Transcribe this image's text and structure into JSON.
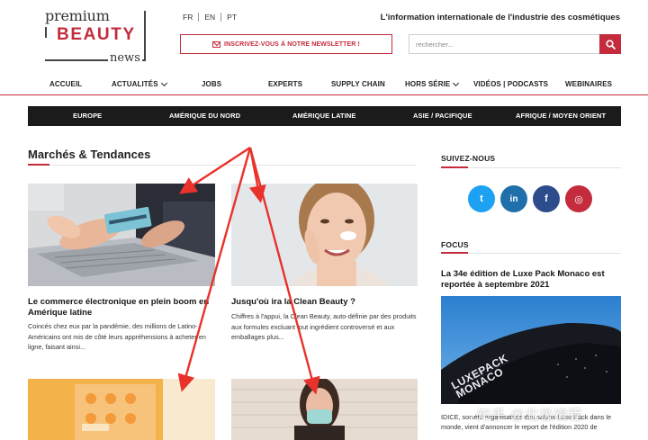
{
  "header": {
    "logo": {
      "line1": "premium",
      "line2": "BEAUTY",
      "line3": "news"
    },
    "languages": [
      "FR",
      "EN",
      "PT"
    ],
    "tagline": "L'information internationale de l'industrie des cosmétiques",
    "newsletter_label": "INSCRIVEZ-VOUS À NOTRE NEWSLETTER !",
    "search_placeholder": "rechercher..."
  },
  "nav": [
    {
      "label": "ACCUEIL",
      "dropdown": false
    },
    {
      "label": "ACTUALITÉS",
      "dropdown": true
    },
    {
      "label": "JOBS",
      "dropdown": false
    },
    {
      "label": "EXPERTS",
      "dropdown": false
    },
    {
      "label": "SUPPLY CHAIN",
      "dropdown": false
    },
    {
      "label": "HORS SÉRIE",
      "dropdown": true
    },
    {
      "label": "VIDÉOS | PODCASTS",
      "dropdown": false
    },
    {
      "label": "WEBINAIRES",
      "dropdown": false
    }
  ],
  "regions": [
    "EUROPE",
    "AMÉRIQUE DU NORD",
    "AMÉRIQUE LATINE",
    "ASIE / PACIFIQUE",
    "AFRIQUE / MOYEN ORIENT"
  ],
  "section": {
    "title": "Marchés & Tendances"
  },
  "articles": [
    {
      "title": "Le commerce électronique en plein boom en Amérique latine",
      "excerpt": "Coincés chez eux par la pandémie, des millions de Latino-Américains ont mis de côté leurs appréhensions à acheter en ligne, faisant ainsi..."
    },
    {
      "title": "Jusqu'où ira la Clean Beauty ?",
      "excerpt": "Chiffres à l'appui, la Clean Beauty, auto-définie par des produits aux formules excluant tout ingrédient controversé et aux emballages plus..."
    }
  ],
  "sidebar": {
    "follow_heading": "SUIVEZ-NOUS",
    "social": [
      {
        "icon": "twitter-icon",
        "glyph": "t",
        "color": "#1da1f2"
      },
      {
        "icon": "linkedin-icon",
        "glyph": "in",
        "color": "#1f6fab"
      },
      {
        "icon": "facebook-icon",
        "glyph": "f",
        "color": "#2d4c8c"
      },
      {
        "icon": "instagram-icon",
        "glyph": "◎",
        "color": "#c42b3c"
      }
    ],
    "focus_heading": "FOCUS",
    "focus_title": "La 34e édition de Luxe Pack Monaco est reportée à septembre 2021",
    "focus_image_text": "LUXEPACK MONACO",
    "focus_text": "IDICE, société organisatrice des salons Luxe Pack dans le monde, vient d'annoncer le report de l'édition 2020 de"
  },
  "watermark": "知乎 @北极编程",
  "colors": {
    "accent": "#c42b3c",
    "region_bar": "#1b1b1b",
    "annotation": "#e8322a"
  }
}
